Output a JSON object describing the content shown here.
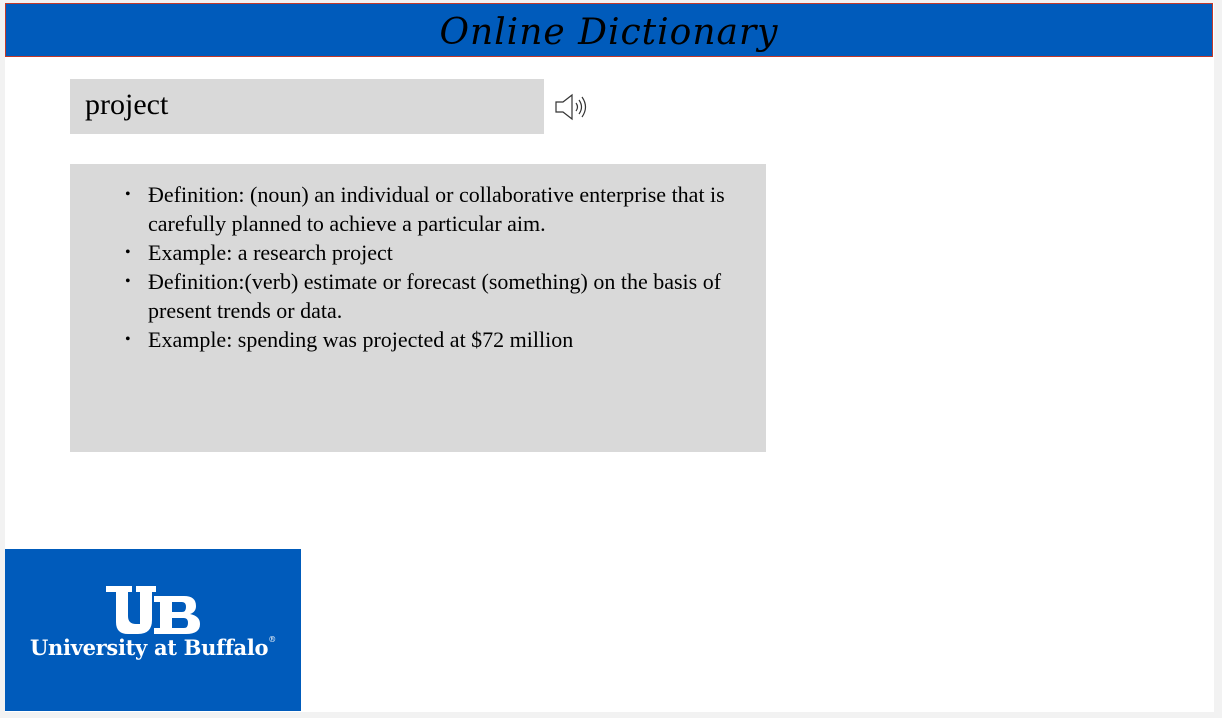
{
  "header": {
    "title": "Online Dictionary"
  },
  "search": {
    "word": "project",
    "speaker_icon": "speaker-icon"
  },
  "definitions": [
    {
      "text": "Ðefinition: (noun) an individual or collaborative enterprise that is carefully planned to achieve a particular aim."
    },
    {
      "text": "Example: a research project"
    },
    {
      "text": "Ðefinition:(verb) estimate or forecast (something) on the basis of present trends or data."
    },
    {
      "text": "Example: spending was projected at $72 million"
    }
  ],
  "logo": {
    "name": "University at Buffalo",
    "mark": "UB",
    "registered": "®"
  },
  "colors": {
    "brand_blue": "#005bbb",
    "panel_gray": "#d9d9d9",
    "title_border": "#c0392b"
  }
}
